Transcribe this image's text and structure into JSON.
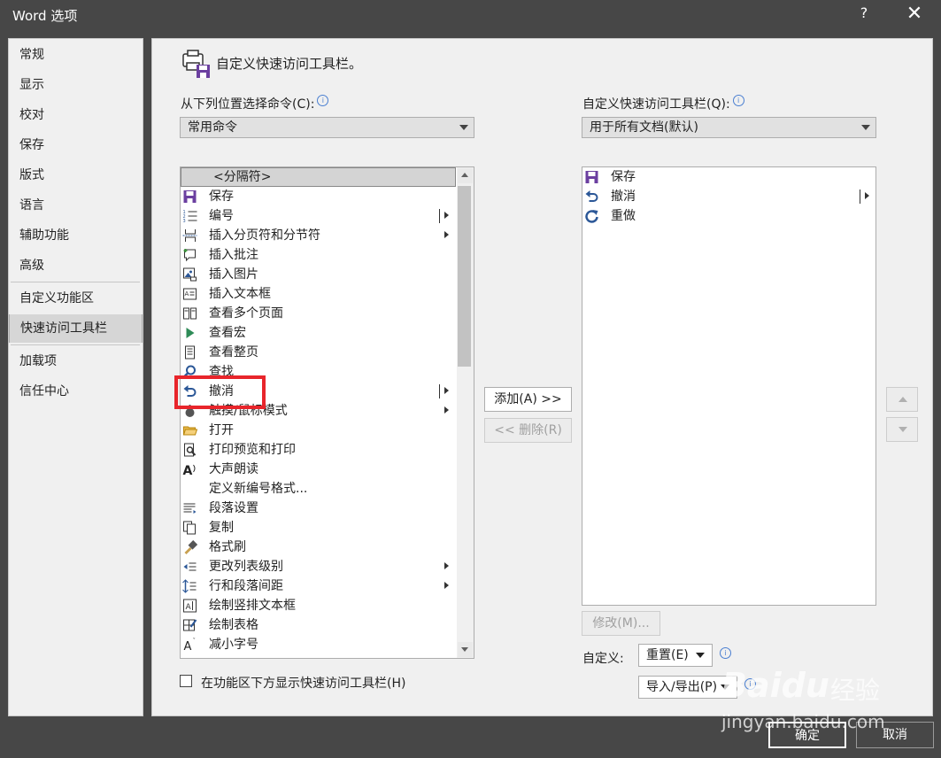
{
  "window": {
    "title": "Word 选项",
    "help": "?",
    "close": "✕"
  },
  "nav": {
    "items": [
      {
        "label": "常规"
      },
      {
        "label": "显示"
      },
      {
        "label": "校对"
      },
      {
        "label": "保存"
      },
      {
        "label": "版式"
      },
      {
        "label": "语言"
      },
      {
        "label": "辅助功能"
      },
      {
        "label": "高级"
      },
      {
        "label": "自定义功能区"
      },
      {
        "label": "快速访问工具栏"
      },
      {
        "label": "加载项"
      },
      {
        "label": "信任中心"
      }
    ],
    "selected": "快速访问工具栏"
  },
  "page": {
    "heading": "自定义快速访问工具栏。",
    "left_label": "从下列位置选择命令(C):",
    "left_select_value": "常用命令",
    "right_label": "自定义快速访问工具栏(Q):",
    "right_select_value": "用于所有文档(默认)"
  },
  "commands": [
    {
      "label": "<分隔符>",
      "icon": "separator"
    },
    {
      "label": "保存",
      "icon": "save-icon"
    },
    {
      "label": "编号",
      "icon": "numbering-icon",
      "submenu": true,
      "bar": true
    },
    {
      "label": "插入分页符和分节符",
      "icon": "page-break-icon",
      "submenu": true
    },
    {
      "label": "插入批注",
      "icon": "comment-icon"
    },
    {
      "label": "插入图片",
      "icon": "picture-icon"
    },
    {
      "label": "插入文本框",
      "icon": "textbox-icon"
    },
    {
      "label": "查看多个页面",
      "icon": "multi-page-icon"
    },
    {
      "label": "查看宏",
      "icon": "macro-icon"
    },
    {
      "label": "查看整页",
      "icon": "full-page-icon"
    },
    {
      "label": "查找",
      "icon": "find-icon"
    },
    {
      "label": "撤消",
      "icon": "undo-icon",
      "submenu": true,
      "bar": true
    },
    {
      "label": "触摸/鼠标模式",
      "icon": "touch-icon",
      "submenu": true
    },
    {
      "label": "打开",
      "icon": "open-folder-icon"
    },
    {
      "label": "打印预览和打印",
      "icon": "print-preview-icon"
    },
    {
      "label": "大声朗读",
      "icon": "read-aloud-icon"
    },
    {
      "label": "定义新编号格式...",
      "icon": "none"
    },
    {
      "label": "段落设置",
      "icon": "paragraph-icon"
    },
    {
      "label": "复制",
      "icon": "copy-icon"
    },
    {
      "label": "格式刷",
      "icon": "format-painter-icon"
    },
    {
      "label": "更改列表级别",
      "icon": "list-level-icon",
      "submenu": true
    },
    {
      "label": "行和段落间距",
      "icon": "line-spacing-icon",
      "submenu": true
    },
    {
      "label": "绘制竖排文本框",
      "icon": "vertical-textbox-icon"
    },
    {
      "label": "绘制表格",
      "icon": "draw-table-icon"
    },
    {
      "label": "减小字号",
      "icon": "decrease-font-icon"
    }
  ],
  "toolbar_items": [
    {
      "label": "保存",
      "icon": "save-icon"
    },
    {
      "label": "撤消",
      "icon": "undo-icon",
      "submenu": true
    },
    {
      "label": "重做",
      "icon": "redo-icon"
    }
  ],
  "buttons": {
    "add": "添加(A) >>",
    "remove": "<< 删除(R)",
    "modify": "修改(M)...",
    "customize_label": "自定义:",
    "reset": "重置(E)",
    "import_export": "导入/导出(P)",
    "ok": "确定",
    "cancel": "取消"
  },
  "checkbox": {
    "label": "在功能区下方显示快速访问工具栏(H)",
    "checked": false
  },
  "watermark": {
    "brand": "Baidu",
    "brand_cn": "经验",
    "url": "jingyan.baidu.com"
  },
  "colors": {
    "accent_purple": "#6b3fa0",
    "undo_blue": "#2b5797",
    "highlight_red": "#e8252b"
  }
}
